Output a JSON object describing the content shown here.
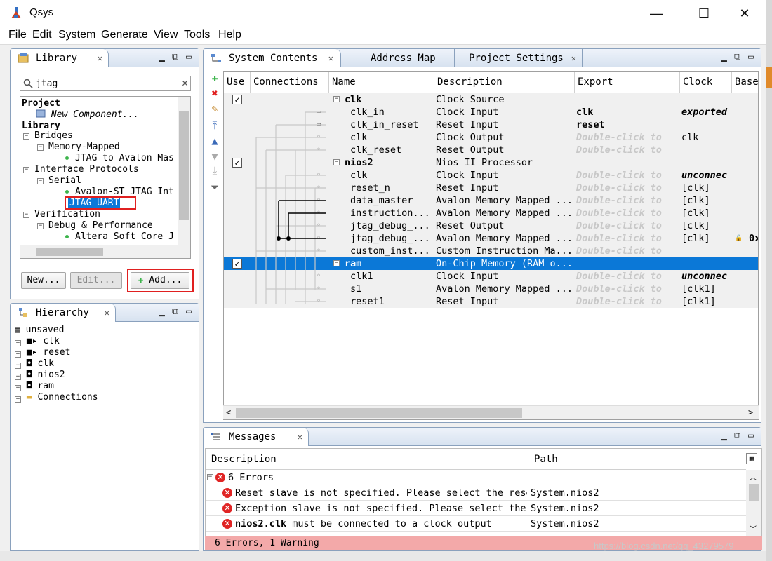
{
  "window": {
    "title": "Qsys",
    "minimize": "—",
    "maximize": "☐",
    "close": "✕"
  },
  "menu": [
    {
      "key": "F",
      "rest": "ile"
    },
    {
      "key": "E",
      "rest": "dit"
    },
    {
      "key": "S",
      "rest": "ystem"
    },
    {
      "key": "G",
      "rest": "enerate"
    },
    {
      "key": "V",
      "rest": "iew"
    },
    {
      "key": "T",
      "rest": "ools"
    },
    {
      "key": "H",
      "rest": "elp"
    }
  ],
  "library": {
    "tab": "Library",
    "search_value": "jtag",
    "tree": {
      "project": "Project",
      "new_component": "New Component...",
      "library": "Library",
      "bridges": "Bridges",
      "memory_mapped": "Memory-Mapped",
      "jtag_avalon": "JTAG to Avalon Mas",
      "interface_protocols": "Interface Protocols",
      "serial": "Serial",
      "avalon_st_jtag": "Avalon-ST JTAG Int",
      "jtag_uart": "JTAG UART",
      "verification": "Verification",
      "debug_perf": "Debug & Performance",
      "altera_soft": "Altera Soft Core J"
    },
    "buttons": {
      "new": "New...",
      "edit": "Edit...",
      "add": "Add..."
    }
  },
  "hierarchy": {
    "tab": "Hierarchy",
    "root": "unsaved",
    "items": [
      "clk",
      "reset",
      "clk",
      "nios2",
      "ram",
      "Connections"
    ]
  },
  "system": {
    "tabs": [
      "System Contents",
      "Address Map",
      "Project Settings"
    ],
    "columns": [
      "Use",
      "Connections",
      "Name",
      "Description",
      "Export",
      "Clock",
      "Base"
    ],
    "rows": [
      {
        "name": "clk",
        "desc": "Clock Source",
        "export": "",
        "clock": "",
        "top": true,
        "checked": true
      },
      {
        "name": "clk_in",
        "desc": "Clock Input",
        "export": "clk",
        "clock": "exported"
      },
      {
        "name": "clk_in_reset",
        "desc": "Reset Input",
        "export": "reset",
        "clock": ""
      },
      {
        "name": "clk",
        "desc": "Clock Output",
        "export": "Double-click to",
        "clock": "clk"
      },
      {
        "name": "clk_reset",
        "desc": "Reset Output",
        "export": "Double-click to",
        "clock": ""
      },
      {
        "name": "nios2",
        "desc": "Nios II Processor",
        "export": "",
        "clock": "",
        "top": true,
        "checked": true
      },
      {
        "name": "clk",
        "desc": "Clock Input",
        "export": "Double-click to",
        "clock": "unconnec"
      },
      {
        "name": "reset_n",
        "desc": "Reset Input",
        "export": "Double-click to",
        "clock": "[clk]"
      },
      {
        "name": "data_master",
        "desc": "Avalon Memory Mapped ...",
        "export": "Double-click to",
        "clock": "[clk]"
      },
      {
        "name": "instruction...",
        "desc": "Avalon Memory Mapped ...",
        "export": "Double-click to",
        "clock": "[clk]"
      },
      {
        "name": "jtag_debug_...",
        "desc": "Reset Output",
        "export": "Double-click to",
        "clock": "[clk]"
      },
      {
        "name": "jtag_debug_...",
        "desc": "Avalon Memory Mapped ...",
        "export": "Double-click to",
        "clock": "[clk]",
        "base": "0x"
      },
      {
        "name": "custom_inst...",
        "desc": "Custom Instruction Ma...",
        "export": "Double-click to",
        "clock": ""
      },
      {
        "name": "ram",
        "desc": "On-Chip Memory (RAM o...",
        "export": "",
        "clock": "",
        "top": true,
        "checked": true,
        "selected": true
      },
      {
        "name": "clk1",
        "desc": "Clock Input",
        "export": "Double-click to",
        "clock": "unconnec"
      },
      {
        "name": "s1",
        "desc": "Avalon Memory Mapped ...",
        "export": "Double-click to",
        "clock": "[clk1]"
      },
      {
        "name": "reset1",
        "desc": "Reset Input",
        "export": "Double-click to",
        "clock": "[clk1]"
      }
    ]
  },
  "messages": {
    "tab": "Messages",
    "columns": [
      "Description",
      "Path"
    ],
    "group": "6 Errors",
    "rows": [
      {
        "desc": "Reset slave is not specified. Please select the rese",
        "path": "System.nios2"
      },
      {
        "desc": "Exception slave is not specified. Please select the",
        "path": "System.nios2"
      },
      {
        "desc_bold": "nios2.clk",
        "desc": " must be connected to a clock output",
        "path": "System.nios2"
      }
    ],
    "status": "6 Errors, 1 Warning"
  },
  "watermark": "https://blog.csdn.net/qq_43279579"
}
